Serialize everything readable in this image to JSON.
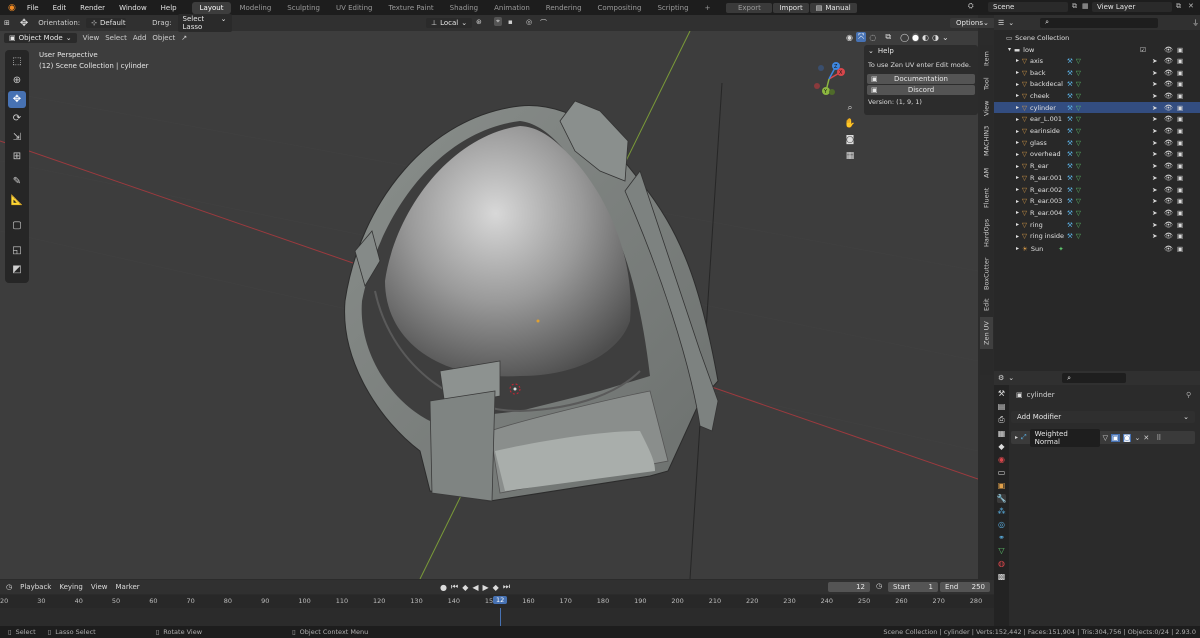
{
  "topbar": {
    "menus": [
      "File",
      "Edit",
      "Render",
      "Window",
      "Help"
    ],
    "workspaces": [
      "Layout",
      "Modeling",
      "Sculpting",
      "UV Editing",
      "Texture Paint",
      "Shading",
      "Animation",
      "Rendering",
      "Compositing",
      "Scripting"
    ],
    "active_workspace": "Layout",
    "add_tab": "+",
    "export_label": "Export",
    "import_label": "Import",
    "manual_label": "Manual",
    "scene_label": "Scene",
    "view_layer_label": "View Layer"
  },
  "viewport_header": {
    "orientation_label": "Orientation:",
    "orientation_value": "Default",
    "drag_label": "Drag:",
    "drag_value": "Select Lasso",
    "transform_orientation": "Local",
    "options_label": "Options",
    "mode": "Object Mode",
    "menus": [
      "View",
      "Select",
      "Add",
      "Object"
    ]
  },
  "viewport": {
    "perspective": "User Perspective",
    "collection_info": "(12) Scene Collection | cylinder",
    "gizmo_axes": [
      "X",
      "Y",
      "Z"
    ]
  },
  "npanel": {
    "title": "Help",
    "text": "To use Zen UV enter Edit mode.",
    "documentation_label": "Documentation",
    "discord_label": "Discord",
    "version": "Version: (1, 9, 1)"
  },
  "sidebar_tabs": [
    "Item",
    "Tool",
    "View",
    "MACHIN3",
    "AM",
    "Fluent",
    "HardOps",
    "BoxCutter",
    "Edit",
    "Zen UV"
  ],
  "active_sidebar_tab": "Zen UV",
  "outliner": {
    "root": "Scene Collection",
    "collection": "low",
    "objects": [
      "axis",
      "back",
      "backdecal",
      "cheek",
      "cylinder",
      "ear_L.001",
      "earinside",
      "glass",
      "overhead",
      "R_ear",
      "R_ear.001",
      "R_ear.002",
      "R_ear.003",
      "R_ear.004",
      "ring",
      "ring inside"
    ],
    "selected_object": "cylinder",
    "light": "Sun"
  },
  "properties": {
    "object_name": "cylinder",
    "add_modifier_label": "Add Modifier",
    "modifier_name": "Weighted Normal"
  },
  "timeline": {
    "menus": [
      "Playback",
      "Keying",
      "View",
      "Marker"
    ],
    "current_frame": "12",
    "start_label": "Start",
    "start_value": "1",
    "end_label": "End",
    "end_value": "250",
    "ruler": [
      "20",
      "30",
      "40",
      "50",
      "60",
      "70",
      "80",
      "90",
      "100",
      "110",
      "120",
      "130",
      "140",
      "150",
      "160",
      "170",
      "180",
      "190",
      "200",
      "210",
      "220",
      "230",
      "240",
      "250",
      "260",
      "270",
      "280"
    ]
  },
  "statusbar": {
    "select": "Select",
    "lasso": "Lasso Select",
    "rotate": "Rotate View",
    "context_menu": "Object Context Menu",
    "stats": "Scene Collection | cylinder | Verts:152,442 | Faces:151,904 | Tris:304,756 | Objects:0/24 | 2.93.0"
  },
  "colors": {
    "accent": "#4772b3",
    "x_axis": "#d8464b",
    "y_axis": "#8cb740",
    "z_axis": "#3e87e0",
    "mesh_icon": "#e0a04a",
    "modifier_icon": "#5aaee0",
    "material_icon": "#5ec46d"
  }
}
